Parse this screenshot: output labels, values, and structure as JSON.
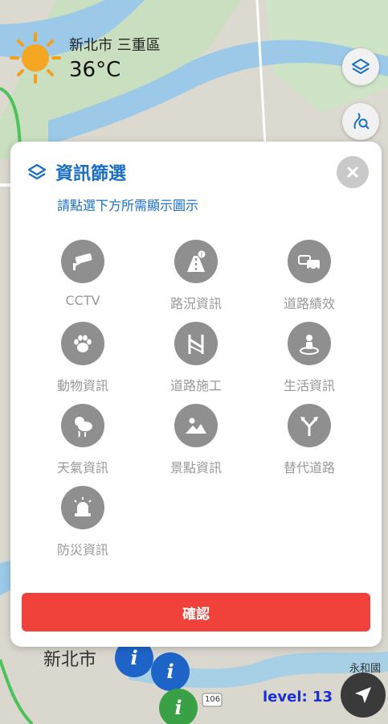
{
  "weather": {
    "location": "新北市 三重區",
    "temperature": "36°C"
  },
  "map": {
    "district_label": "新北市",
    "area_label": "永和國",
    "road_badge": "106",
    "zoom_level_text": "level: 13"
  },
  "filter_panel": {
    "title": "資訊篩選",
    "subtitle": "請點選下方所需顯示圖示",
    "items": [
      {
        "label": "CCTV",
        "icon": "cctv-icon"
      },
      {
        "label": "路況資訊",
        "icon": "road-info-icon"
      },
      {
        "label": "道路績效",
        "icon": "traffic-cars-icon"
      },
      {
        "label": "動物資訊",
        "icon": "paw-icon"
      },
      {
        "label": "道路施工",
        "icon": "construction-icon"
      },
      {
        "label": "生活資訊",
        "icon": "person-location-icon"
      },
      {
        "label": "天氣資訊",
        "icon": "weather-icon"
      },
      {
        "label": "景點資訊",
        "icon": "scenery-icon"
      },
      {
        "label": "替代道路",
        "icon": "fork-arrow-icon"
      },
      {
        "label": "防災資訊",
        "icon": "siren-icon"
      }
    ],
    "confirm_label": "確認"
  },
  "colors": {
    "accent_blue": "#1a6fc0",
    "confirm_red": "#f0413b",
    "icon_gray": "#8f8f8f",
    "level_blue": "#1b2fd6"
  }
}
